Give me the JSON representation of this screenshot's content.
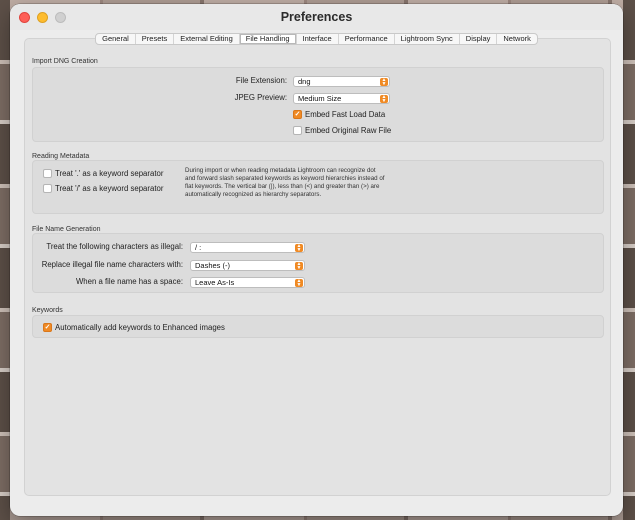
{
  "window": {
    "title": "Preferences"
  },
  "tabs": [
    {
      "label": "General",
      "active": false
    },
    {
      "label": "Presets",
      "active": false
    },
    {
      "label": "External Editing",
      "active": false
    },
    {
      "label": "File Handling",
      "active": true
    },
    {
      "label": "Interface",
      "active": false
    },
    {
      "label": "Performance",
      "active": false
    },
    {
      "label": "Lightroom Sync",
      "active": false
    },
    {
      "label": "Display",
      "active": false
    },
    {
      "label": "Network",
      "active": false
    }
  ],
  "import_dng": {
    "section_title": "Import DNG Creation",
    "file_extension_label": "File Extension:",
    "file_extension_value": "dng",
    "jpeg_preview_label": "JPEG Preview:",
    "jpeg_preview_value": "Medium Size",
    "embed_fast_load_label": "Embed Fast Load Data",
    "embed_fast_load_checked": true,
    "embed_original_label": "Embed Original Raw File",
    "embed_original_checked": false
  },
  "reading_metadata": {
    "section_title": "Reading Metadata",
    "dot_separator_label": "Treat '.' as a keyword separator",
    "dot_separator_checked": false,
    "slash_separator_label": "Treat '/' as a keyword separator",
    "slash_separator_checked": false,
    "description": "During import or when reading metadata Lightroom can recognize dot and forward slash separated keywords as keyword hierarchies instead of flat keywords. The vertical bar (|), less than (<) and greater than (>) are automatically recognized as hierarchy separators."
  },
  "file_name_generation": {
    "section_title": "File Name Generation",
    "illegal_chars_label": "Treat the following characters as illegal:",
    "illegal_chars_value": "/ :",
    "replace_label": "Replace illegal file name characters with:",
    "replace_value": "Dashes (-)",
    "space_label": "When a file name has a space:",
    "space_value": "Leave As-Is"
  },
  "keywords": {
    "section_title": "Keywords",
    "auto_add_label": "Automatically add keywords to Enhanced images",
    "auto_add_checked": true
  },
  "colors": {
    "accent": "#f08a24",
    "close": "#fe5f57",
    "minimize": "#febc2e"
  }
}
